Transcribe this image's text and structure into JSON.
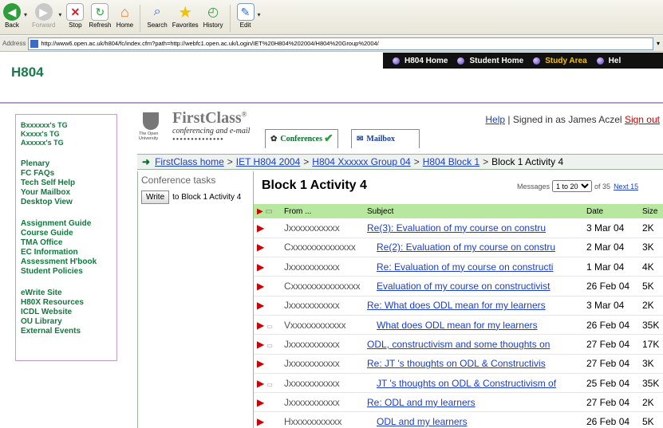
{
  "toolbar": {
    "buttons": [
      {
        "label": "Back",
        "icon": "back-arrow-icon",
        "color": "#2e9e3a"
      },
      {
        "label": "Forward",
        "icon": "forward-arrow-icon",
        "color": "#9a9a9a"
      },
      {
        "label": "Stop",
        "icon": "stop-icon",
        "color": "#d62020"
      },
      {
        "label": "Refresh",
        "icon": "refresh-icon",
        "color": "#2e9e3a"
      },
      {
        "label": "Home",
        "icon": "home-icon",
        "color": "#e07a20"
      },
      {
        "label": "Search",
        "icon": "search-icon",
        "color": "#3a6bc5"
      },
      {
        "label": "Favorites",
        "icon": "star-icon",
        "color": "#f2c400"
      },
      {
        "label": "History",
        "icon": "history-icon",
        "color": "#2e9e3a"
      },
      {
        "label": "Edit",
        "icon": "edit-icon",
        "color": "#3a6bc5"
      }
    ]
  },
  "address": {
    "label": "Address",
    "url": "http://www6.open.ac.uk/h804/fc/index.cfm?path=http://webfc1.open.ac.uk/Login/IET%20H804%202004/H804%20Group%2004/"
  },
  "topnav": {
    "items": [
      {
        "label": "H804 Home",
        "active": false
      },
      {
        "label": "Student Home",
        "active": false
      },
      {
        "label": "Study Area",
        "active": true
      },
      {
        "label": "Hel",
        "active": false
      }
    ]
  },
  "brand": "H804",
  "sidebar": {
    "tgs": [
      "Bxxxxxx's TG",
      "Kxxxx's TG",
      "Axxxxx's TG"
    ],
    "group1": [
      "Plenary",
      "FC FAQs",
      "Tech Self Help",
      "Your Mailbox",
      "Desktop View"
    ],
    "group2": [
      "Assignment Guide",
      "Course Guide",
      "TMA Office",
      "EC Information",
      "Assessment H'book",
      "Student Policies"
    ],
    "group3": [
      "eWrite Site",
      "H80X Resources",
      "ICDL Website",
      "OU Library",
      "External Events"
    ]
  },
  "fc": {
    "title": "FirstClass",
    "reg": "®",
    "subtitle": "conferencing and e-mail",
    "ou": "The Open University",
    "tab_conferences": "Conferences",
    "tab_mailbox": "Mailbox",
    "help": "Help",
    "signed_in": "| Signed in as James Aczel",
    "sign_out": "Sign out"
  },
  "breadcrumb": {
    "items": [
      "FirstClass home",
      "IET H804 2004",
      "H804 Xxxxxx Group 04",
      "H804 Block 1"
    ],
    "current": "Block 1 Activity 4"
  },
  "tasks": {
    "label": "Conference tasks",
    "write": "Write",
    "write_to": "to Block 1 Activity 4"
  },
  "messages": {
    "heading": "Block 1 Activity 4",
    "pager_label": "Messages",
    "pager_value": "1 to 20",
    "pager_total": "of 35",
    "next": "Next 15",
    "columns": {
      "from": "From",
      "subject": "Subject",
      "date": "Date",
      "size": "Size"
    },
    "rows": [
      {
        "from": "Jxxxxxxxxxxx",
        "subject": "Re(3): Evaluation of my course on constru",
        "date": "3 Mar 04",
        "size": "2K",
        "indent": 0,
        "unread": false
      },
      {
        "from": "Cxxxxxxxxxxxxxx",
        "subject": "Re(2): Evaluation of my course on constru",
        "date": "2 Mar 04",
        "size": "3K",
        "indent": 1,
        "unread": false
      },
      {
        "from": "Jxxxxxxxxxxx",
        "subject": "Re: Evaluation of my course on constructi",
        "date": "1 Mar 04",
        "size": "4K",
        "indent": 1,
        "unread": false
      },
      {
        "from": "Cxxxxxxxxxxxxxxx",
        "subject": "Evaluation of my course on constructivist",
        "date": "26 Feb 04",
        "size": "5K",
        "indent": 1,
        "unread": false
      },
      {
        "from": "Jxxxxxxxxxxx",
        "subject": "Re: What does ODL mean for my learners",
        "date": "3 Mar 04",
        "size": "2K",
        "indent": 0,
        "unread": false
      },
      {
        "from": "Vxxxxxxxxxxxx",
        "subject": "What does ODL mean for my learners",
        "date": "26 Feb 04",
        "size": "35K",
        "indent": 1,
        "unread": true
      },
      {
        "from": "Jxxxxxxxxxxx",
        "subject": "ODL, constructivism and some thoughts on",
        "date": "27 Feb 04",
        "size": "17K",
        "indent": 0,
        "unread": true
      },
      {
        "from": "Jxxxxxxxxxxx",
        "subject": "Re: JT 's thoughts on ODL & Constructivis",
        "date": "27 Feb 04",
        "size": "3K",
        "indent": 0,
        "unread": false
      },
      {
        "from": "Jxxxxxxxxxxx",
        "subject": "JT 's thoughts on ODL & Constructivism of",
        "date": "25 Feb 04",
        "size": "35K",
        "indent": 1,
        "unread": true
      },
      {
        "from": "Jxxxxxxxxxxx",
        "subject": "Re: ODL and my learners",
        "date": "27 Feb 04",
        "size": "2K",
        "indent": 0,
        "unread": false
      },
      {
        "from": "Hxxxxxxxxxxx",
        "subject": "ODL and my learners",
        "date": "26 Feb 04",
        "size": "5K",
        "indent": 1,
        "unread": false
      }
    ]
  },
  "colors": {
    "green": "#1a7a4c",
    "link": "#1a3dcc",
    "header_row": "#b8e8a0",
    "flag": "#cc0000"
  }
}
